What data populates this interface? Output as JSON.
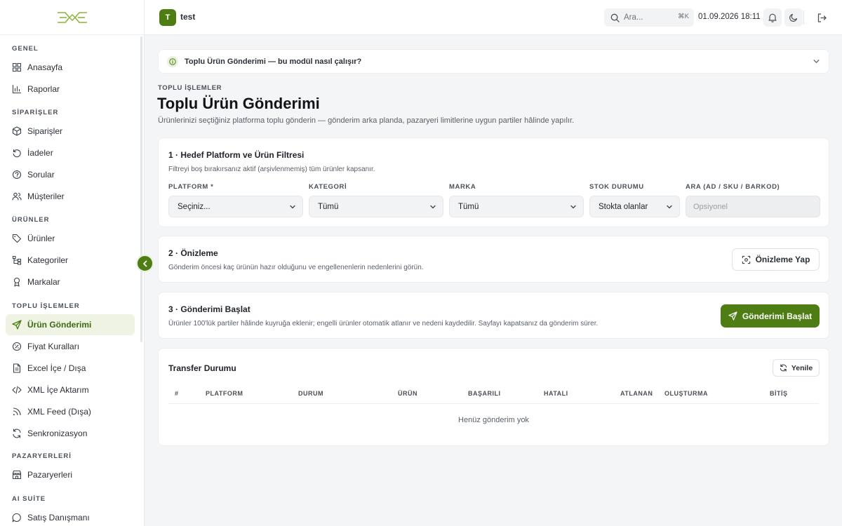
{
  "sidebar": {
    "sections": [
      {
        "title": "GENEL",
        "items": [
          {
            "label": "Anasayfa",
            "icon": "grid-icon"
          },
          {
            "label": "Raporlar",
            "icon": "bar-chart-icon"
          }
        ]
      },
      {
        "title": "SİPARİŞLER",
        "items": [
          {
            "label": "Siparişler",
            "icon": "box-icon"
          },
          {
            "label": "İadeler",
            "icon": "undo-icon"
          },
          {
            "label": "Sorular",
            "icon": "help-circle-icon"
          },
          {
            "label": "Müşteriler",
            "icon": "users-icon"
          }
        ]
      },
      {
        "title": "ÜRÜNLER",
        "items": [
          {
            "label": "Ürünler",
            "icon": "tag-icon"
          },
          {
            "label": "Kategoriler",
            "icon": "tree-icon"
          },
          {
            "label": "Markalar",
            "icon": "award-icon"
          }
        ]
      },
      {
        "title": "TOPLU İŞLEMLER",
        "items": [
          {
            "label": "Ürün Gönderimi",
            "icon": "send-icon",
            "active": true
          },
          {
            "label": "Fiyat Kuralları",
            "icon": "percent-icon"
          },
          {
            "label": "Excel İçe / Dışa",
            "icon": "file-icon"
          },
          {
            "label": "XML İçe Aktarım",
            "icon": "code-icon"
          },
          {
            "label": "XML Feed (Dışa)",
            "icon": "rss-icon"
          },
          {
            "label": "Senkronizasyon",
            "icon": "sync-icon"
          }
        ]
      },
      {
        "title": "PAZARYERLERİ",
        "items": [
          {
            "label": "Pazaryerleri",
            "icon": "store-icon"
          }
        ]
      },
      {
        "title": "AI SUİTE",
        "items": [
          {
            "label": "Satış Danışmanı",
            "icon": "chat-icon"
          }
        ]
      }
    ]
  },
  "header": {
    "workspace_initial": "T",
    "workspace_name": "test",
    "search_placeholder": "Ara...",
    "search_shortcut": "⌘K",
    "datetime": "01.09.2026 18:11"
  },
  "info_bar": {
    "text": "Toplu Ürün Gönderimi — bu modül nasıl çalışır?"
  },
  "page": {
    "eyebrow": "TOPLU İŞLEMLER",
    "title": "Toplu Ürün Gönderimi",
    "subtitle": "Ürünlerinizi seçtiğiniz platforma toplu gönderin — gönderim arka planda, pazaryeri limitlerine uygun partiler hâlinde yapılır."
  },
  "step1": {
    "title": "1 · Hedef Platform ve Ürün Filtresi",
    "subtitle": "Filtreyi boş bırakırsanız aktif (arşivlenmemiş) tüm ürünler kapsanır.",
    "platform_label": "PLATFORM *",
    "platform_value": "Seçiniz...",
    "category_label": "KATEGORİ",
    "category_value": "Tümü",
    "brand_label": "MARKA",
    "brand_value": "Tümü",
    "stock_label": "STOK DURUMU",
    "stock_value": "Stokta olanlar",
    "search_label": "ARA (AD / SKU / BARKOD)",
    "search_placeholder": "Opsiyonel"
  },
  "step2": {
    "title": "2 · Önizleme",
    "subtitle": "Gönderim öncesi kaç ürünün hazır olduğunu ve engellenenlerin nedenlerini görün.",
    "button": "Önizleme Yap"
  },
  "step3": {
    "title": "3 · Gönderimi Başlat",
    "subtitle": "Ürünler 100'lük partiler hâlinde kuyruğa eklenir; engelli ürünler otomatik atlanır ve nedeni kaydedilir. Sayfayı kapatsanız da gönderim sürer.",
    "button": "Gönderimi Başlat"
  },
  "transfer": {
    "title": "Transfer Durumu",
    "refresh": "Yenile",
    "columns": [
      "#",
      "PLATFORM",
      "DURUM",
      "ÜRÜN",
      "BAŞARILI",
      "HATALI",
      "ATLANAN",
      "OLUŞTURMA",
      "BİTİŞ"
    ],
    "empty": "Henüz gönderim yok"
  },
  "colors": {
    "accent": "#4e7d14",
    "active_bg": "#eef3e3"
  }
}
